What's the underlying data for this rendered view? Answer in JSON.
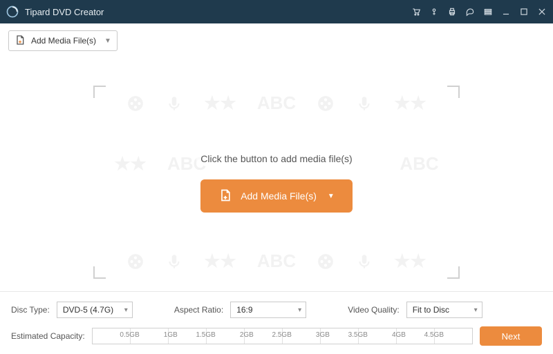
{
  "titlebar": {
    "title": "Tipard DVD Creator"
  },
  "toolbar": {
    "add_media_label": "Add Media File(s)"
  },
  "main": {
    "prompt": "Click the button to add media file(s)",
    "add_media_label": "Add Media File(s)",
    "ghost_text": "ABC"
  },
  "footer": {
    "disc_type_label": "Disc Type:",
    "disc_type_value": "DVD-5 (4.7G)",
    "aspect_ratio_label": "Aspect Ratio:",
    "aspect_ratio_value": "16:9",
    "video_quality_label": "Video Quality:",
    "video_quality_value": "Fit to Disc",
    "capacity_label": "Estimated Capacity:",
    "ruler_ticks": [
      "0.5GB",
      "1GB",
      "1.5GB",
      "2GB",
      "2.5GB",
      "3GB",
      "3.5GB",
      "4GB",
      "4.5GB"
    ],
    "next_label": "Next"
  },
  "colors": {
    "accent": "#ec8b3e",
    "titlebar": "#1f3a4d"
  }
}
